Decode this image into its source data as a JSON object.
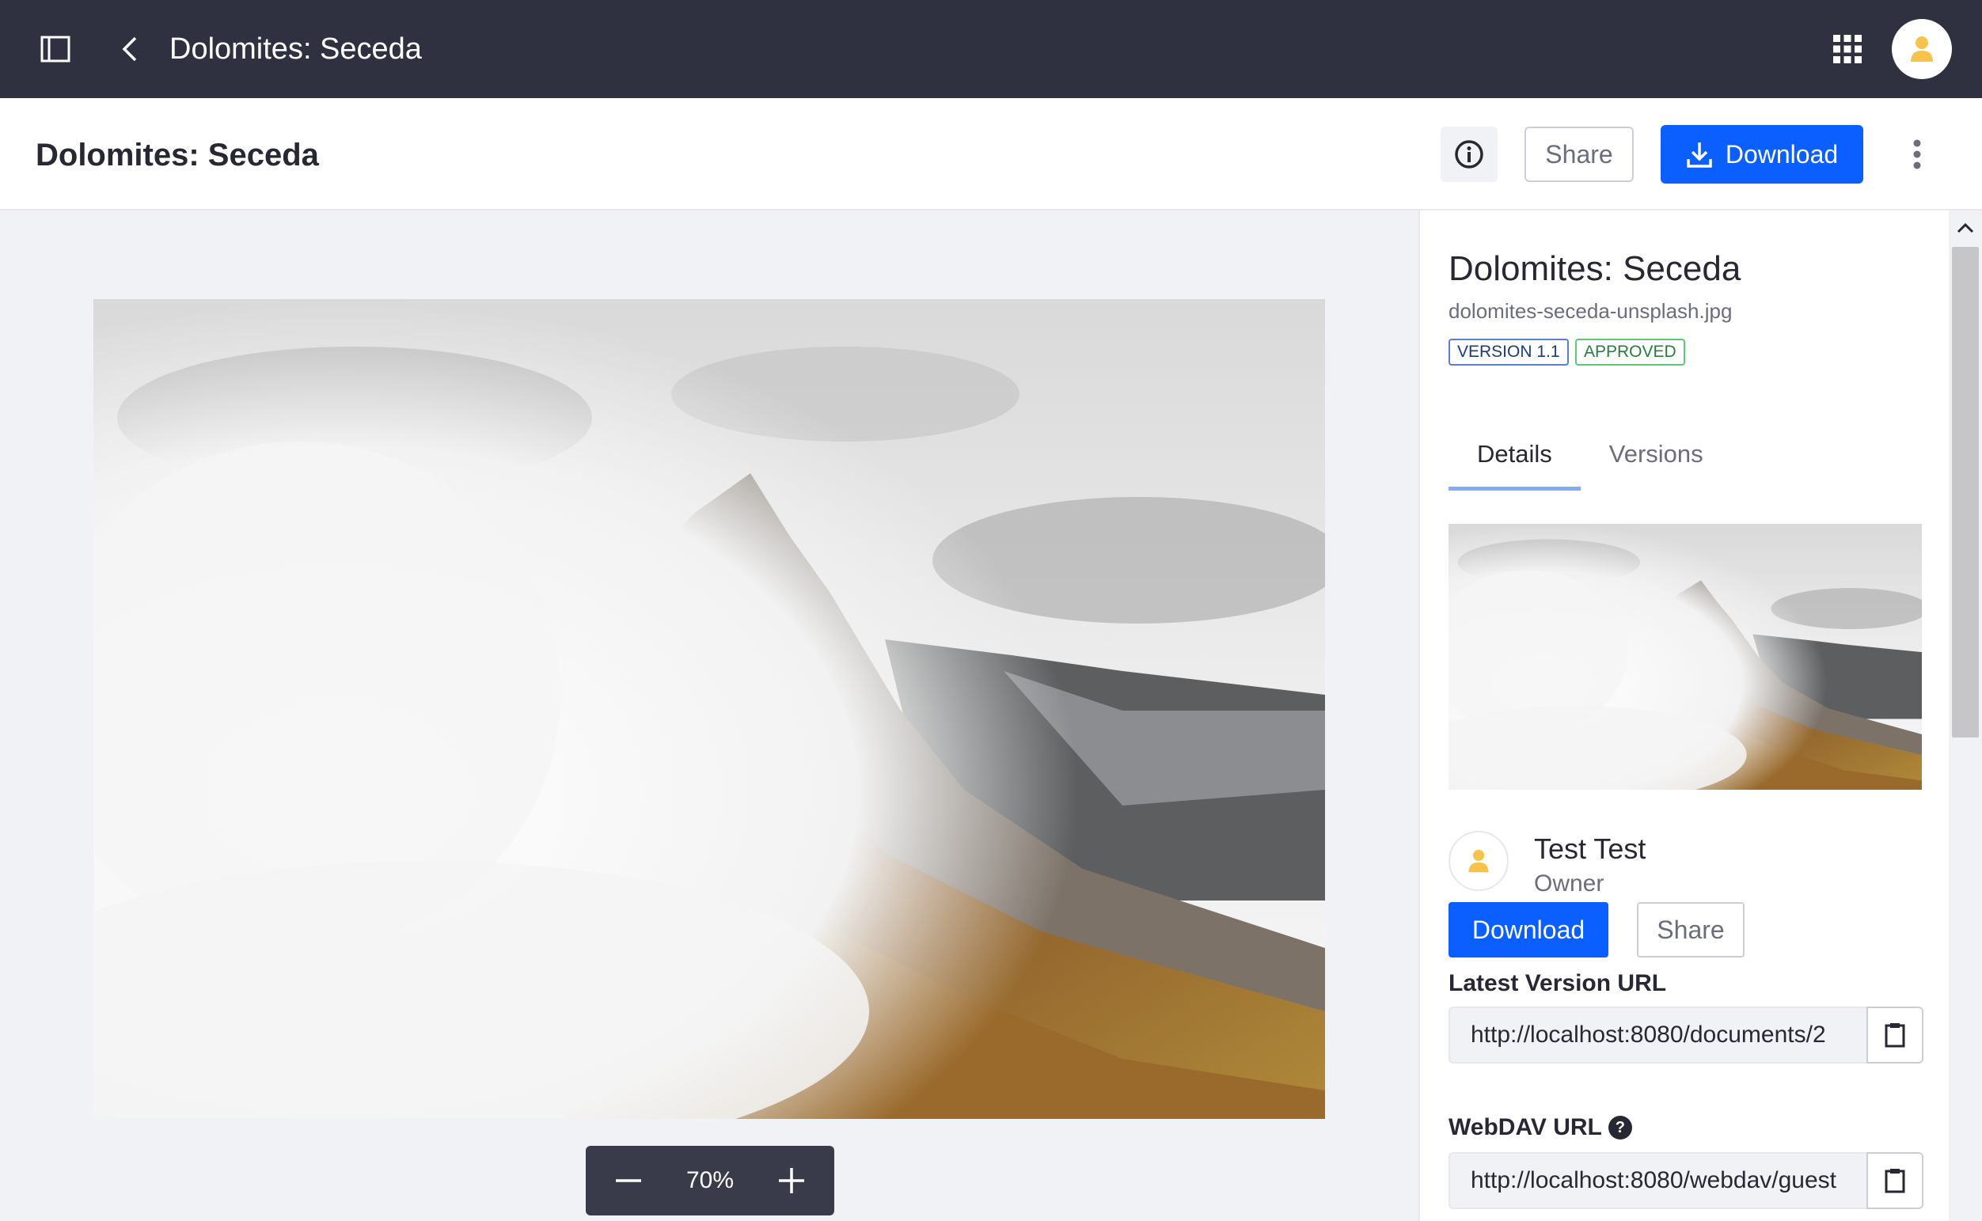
{
  "app": {
    "title": "Dolomites: Seceda"
  },
  "header": {
    "title": "Dolomites: Seceda",
    "share_label": "Share",
    "download_label": "Download"
  },
  "viewer": {
    "zoom": "70%"
  },
  "sidepanel": {
    "title": "Dolomites: Seceda",
    "file_name": "dolomites-seceda-unsplash.jpg",
    "badges": {
      "version": "VERSION 1.1",
      "status": "APPROVED"
    },
    "tabs": [
      {
        "label": "Details",
        "active": true
      },
      {
        "label": "Versions",
        "active": false
      }
    ],
    "owner": {
      "name": "Test Test",
      "role": "Owner"
    },
    "download_label": "Download",
    "share_label": "Share",
    "latest_version_url": {
      "label": "Latest Version URL",
      "value": "http://localhost:8080/documents/2"
    },
    "webdav_url": {
      "label": "WebDAV URL",
      "value": "http://localhost:8080/webdav/guest"
    }
  },
  "colors": {
    "topbar": "#2f3140",
    "primary": "#0b5fff",
    "approved": "#287d3c",
    "version": "#1c3b7a"
  }
}
